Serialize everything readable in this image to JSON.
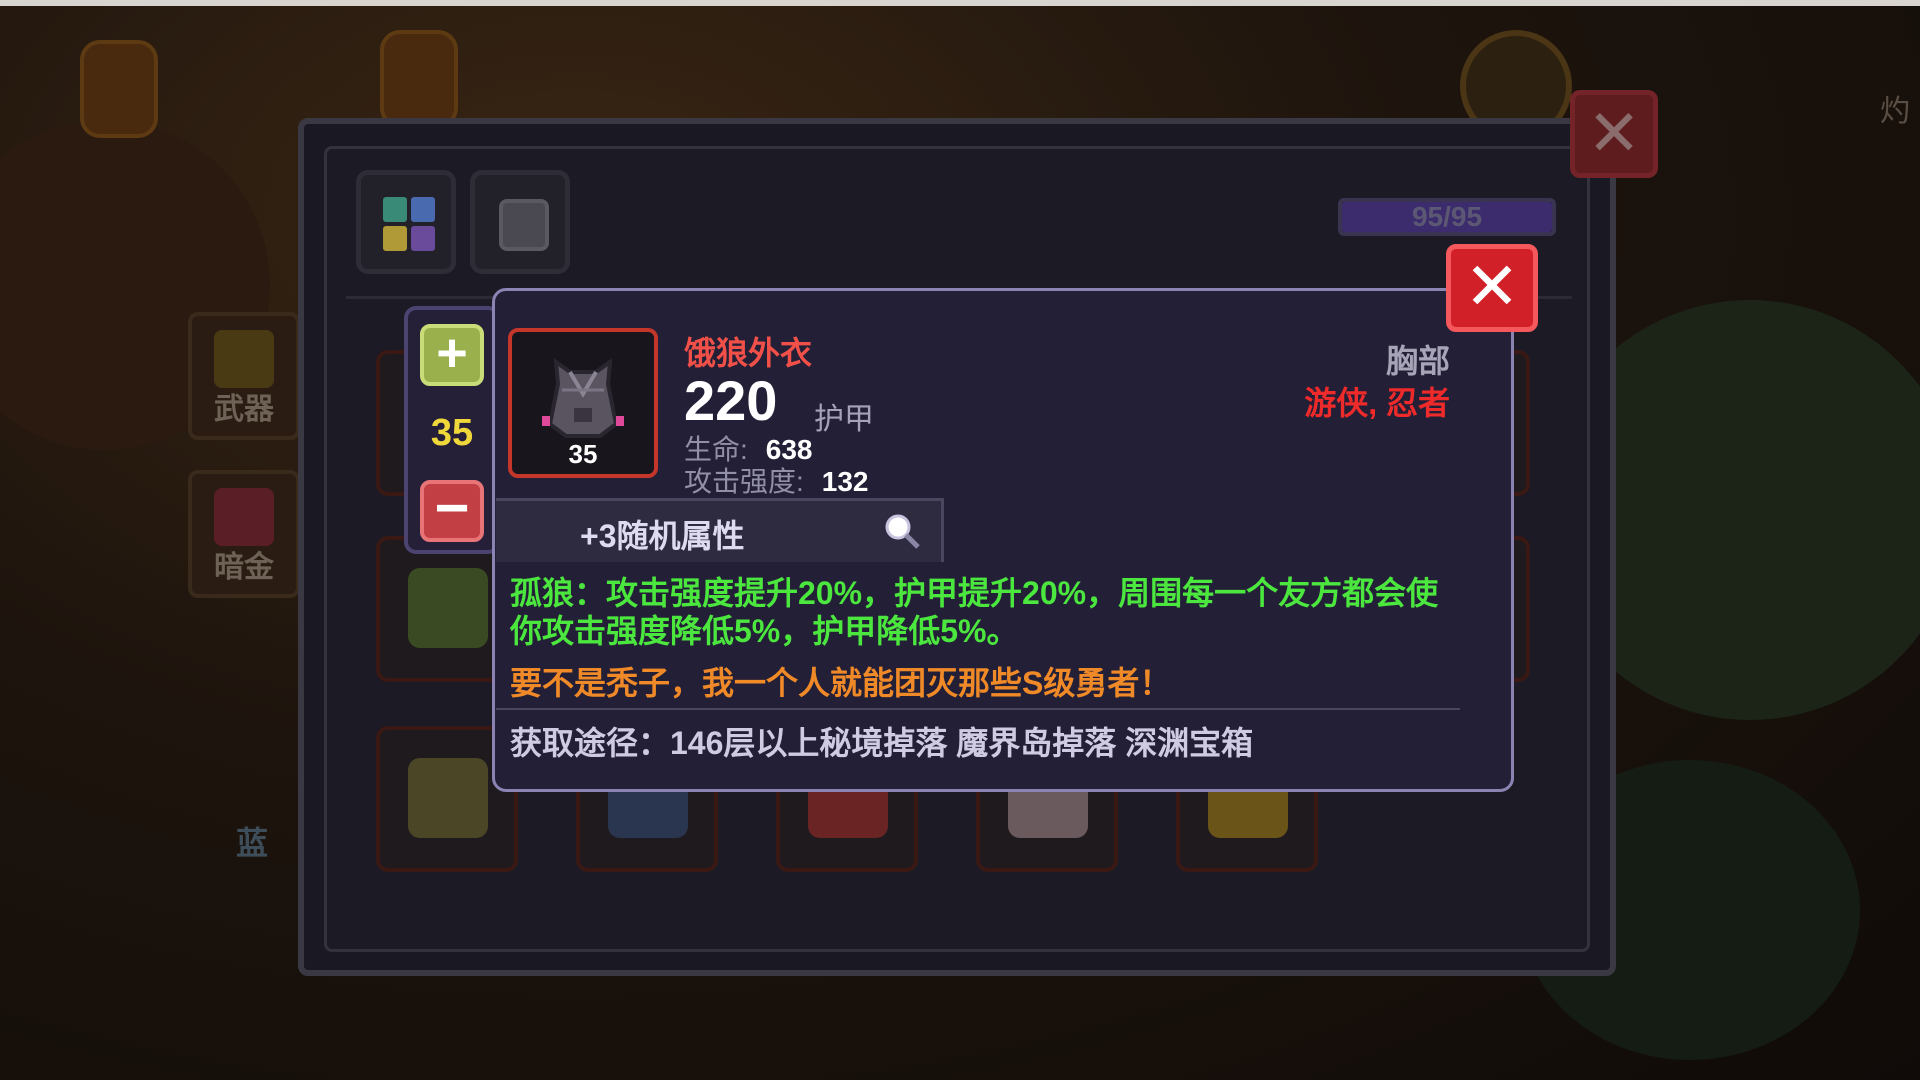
{
  "background": {
    "side_tabs": [
      {
        "label": "武器"
      },
      {
        "label": "暗金"
      }
    ],
    "partial_label_left": "蓝",
    "partial_label_right": "灼"
  },
  "inventory": {
    "capacity_text": "95/95",
    "capacity_used": 95,
    "capacity_max": 95,
    "tabs": [
      {
        "icon": "all-items-grid-icon"
      },
      {
        "icon": "armor-icon"
      }
    ]
  },
  "stepper": {
    "level": "35",
    "plus_icon": "plus-icon",
    "minus_icon": "minus-icon"
  },
  "item": {
    "name": "饿狼外衣",
    "level": "35",
    "armor_value": "220",
    "armor_label": "护甲",
    "stats": [
      {
        "label": "生命:",
        "value": "638"
      },
      {
        "label": "攻击强度:",
        "value": "132"
      }
    ],
    "slot": "胸部",
    "classes": "游侠, 忍者",
    "random_attributes": "+3随机属性",
    "effect": "孤狼：攻击强度提升20%，护甲提升20%，周围每一个友方都会使你攻击强度降低5%，护甲降低5%。",
    "flavor": "要不是秃子，我一个人就能团灭那些S级勇者！",
    "source": "获取途径：146层以上秘境掉落 魔界岛掉落 深渊宝箱"
  },
  "colors": {
    "item_name": "#f05048",
    "effect_text": "#4be63e",
    "flavor_text": "#f08a28",
    "classes_text": "#ee2a2a",
    "level_text": "#f0d83a",
    "close_button": "#d22028"
  }
}
